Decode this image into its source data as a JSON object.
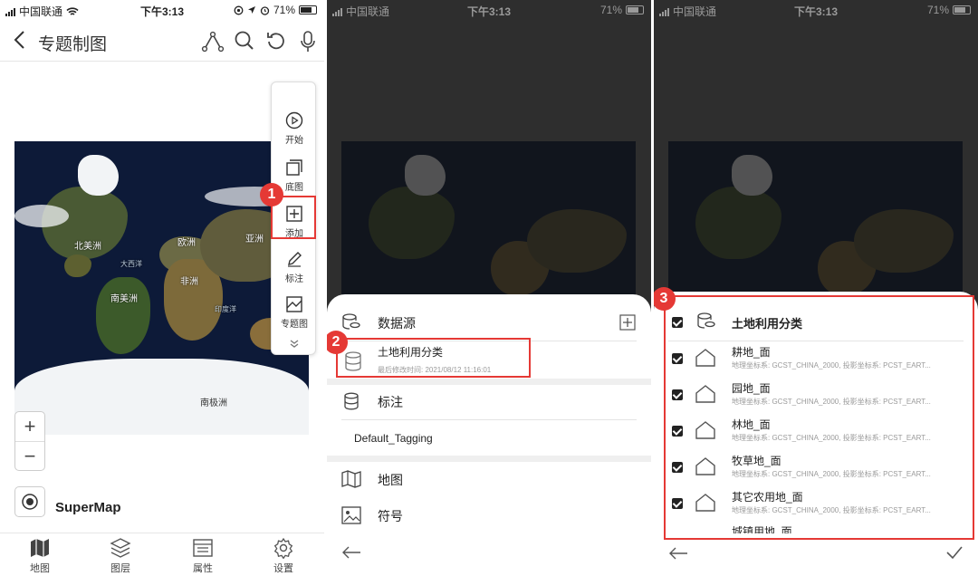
{
  "status": {
    "carrier": "中国联通",
    "time": "下午3:13",
    "battery": "71%"
  },
  "panel1": {
    "title": "专题制图",
    "map_labels": {
      "north_america": "北美洲",
      "europe": "欧洲",
      "asia": "亚洲",
      "africa": "非洲",
      "south_america": "南美洲",
      "antarctica": "南极洲",
      "atlantic": "大西洋",
      "indian": "印度洋"
    },
    "toolbar": [
      "开始",
      "底图",
      "添加",
      "标注",
      "专题图"
    ],
    "callout": "1",
    "brand": "SuperMap",
    "tabs": [
      "地图",
      "图层",
      "属性",
      "设置"
    ]
  },
  "panel2": {
    "callout": "2",
    "datasource_label": "数据源",
    "item_name": "土地利用分类",
    "item_modified": "最后修改时间: 2021/08/12 11:16:01",
    "tagging_label": "标注",
    "tagging_item": "Default_Tagging",
    "map_label": "地图",
    "symbol_label": "符号"
  },
  "panel3": {
    "callout": "3",
    "group_name": "土地利用分类",
    "items": [
      {
        "name": "耕地_面",
        "desc": "地理坐标系: GCST_CHINA_2000, 投影坐标系: PCST_EART..."
      },
      {
        "name": "园地_面",
        "desc": "地理坐标系: GCST_CHINA_2000, 投影坐标系: PCST_EART..."
      },
      {
        "name": "林地_面",
        "desc": "地理坐标系: GCST_CHINA_2000, 投影坐标系: PCST_EART..."
      },
      {
        "name": "牧草地_面",
        "desc": "地理坐标系: GCST_CHINA_2000, 投影坐标系: PCST_EART..."
      },
      {
        "name": "其它农用地_面",
        "desc": "地理坐标系: GCST_CHINA_2000, 投影坐标系: PCST_EART..."
      }
    ],
    "partial_item": "城镇用地_面"
  },
  "colors": {
    "accent_red": "#e53935",
    "overlay": "#2e2e2e"
  }
}
